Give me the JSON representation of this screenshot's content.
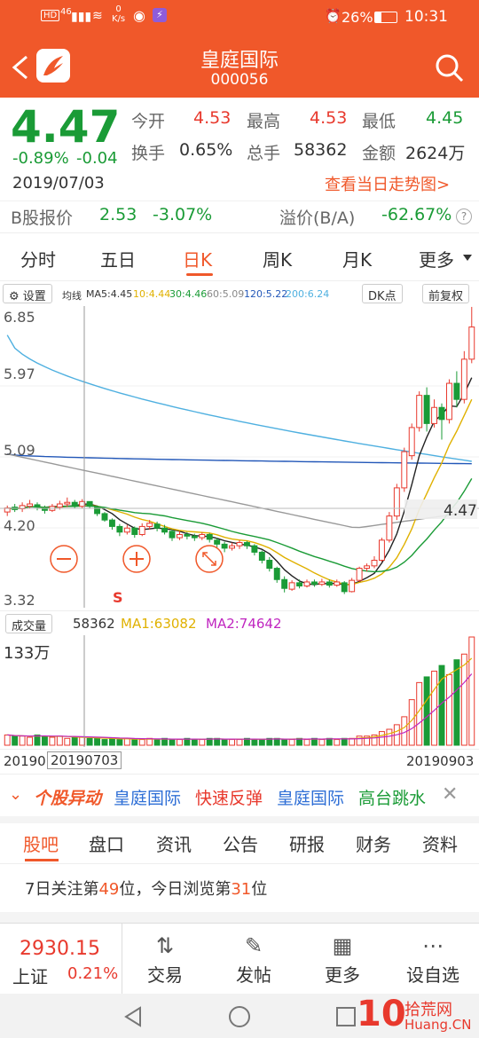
{
  "status": {
    "net": "46",
    "speed_top": "0",
    "speed_unit": "K/s",
    "battery": "26%",
    "time": "10:31"
  },
  "header": {
    "title": "皇庭国际",
    "code": "000056"
  },
  "quote": {
    "price": "4.47",
    "change_pct": "-0.89%",
    "change": "-0.04",
    "date": "2019/07/03",
    "fields": [
      {
        "label": "今开",
        "value": "4.53",
        "color": "red"
      },
      {
        "label": "最高",
        "value": "4.53",
        "color": "red"
      },
      {
        "label": "最低",
        "value": "4.45",
        "color": "green"
      },
      {
        "label": "换手",
        "value": "0.65%",
        "color": "normal"
      },
      {
        "label": "总手",
        "value": "58362",
        "color": "normal"
      },
      {
        "label": "金额",
        "value": "2624万",
        "color": "normal"
      }
    ],
    "trend_link": "查看当日走势图>",
    "b_label": "B股报价",
    "b_price": "2.53",
    "b_pct": "-3.07%",
    "premium_label": "溢价(B/A)",
    "premium_value": "-62.67%",
    "help_icon": "?"
  },
  "tabs": [
    "分时",
    "五日",
    "日K",
    "周K",
    "月K",
    "更多"
  ],
  "active_tab": 2,
  "chart_toolbar": {
    "settings": "设置",
    "ma_label": "均线",
    "ma5": "MA5:4.45",
    "ma10": "10:4.44",
    "ma30": "30:4.46",
    "ma60": "60:5.09",
    "ma120": "120:5.22",
    "ma200": "200:6.24",
    "dk": "DK点",
    "adjust": "前复权"
  },
  "chart_data": {
    "type": "candlestick",
    "y_ticks": [
      "6.85",
      "5.97",
      "5.09",
      "4.20",
      "3.32"
    ],
    "ylim": [
      3.32,
      6.85
    ],
    "current_price_label": "4.47",
    "marker": "S",
    "candles": [
      [
        4.4,
        4.45,
        4.35,
        4.48
      ],
      [
        4.46,
        4.43,
        4.4,
        4.5
      ],
      [
        4.44,
        4.48,
        4.4,
        4.52
      ],
      [
        4.47,
        4.5,
        4.44,
        4.55
      ],
      [
        4.49,
        4.46,
        4.42,
        4.52
      ],
      [
        4.45,
        4.42,
        4.38,
        4.48
      ],
      [
        4.42,
        4.47,
        4.4,
        4.5
      ],
      [
        4.46,
        4.5,
        4.43,
        4.54
      ],
      [
        4.5,
        4.52,
        4.46,
        4.58
      ],
      [
        4.52,
        4.47,
        4.45,
        4.55
      ],
      [
        4.47,
        4.53,
        4.44,
        4.56
      ],
      [
        4.53,
        4.47,
        4.45,
        4.53
      ],
      [
        4.46,
        4.38,
        4.35,
        4.48
      ],
      [
        4.38,
        4.3,
        4.28,
        4.4
      ],
      [
        4.3,
        4.22,
        4.18,
        4.32
      ],
      [
        4.22,
        4.15,
        4.1,
        4.25
      ],
      [
        4.15,
        4.2,
        4.12,
        4.24
      ],
      [
        4.2,
        4.12,
        4.08,
        4.22
      ],
      [
        4.12,
        4.22,
        4.1,
        4.26
      ],
      [
        4.22,
        4.26,
        4.18,
        4.3
      ],
      [
        4.25,
        4.2,
        4.16,
        4.28
      ],
      [
        4.2,
        4.15,
        4.12,
        4.24
      ],
      [
        4.16,
        4.08,
        4.04,
        4.18
      ],
      [
        4.08,
        4.12,
        4.05,
        4.16
      ],
      [
        4.12,
        4.1,
        4.06,
        4.15
      ],
      [
        4.1,
        4.08,
        4.04,
        4.13
      ],
      [
        4.08,
        4.12,
        4.05,
        4.15
      ],
      [
        4.12,
        4.06,
        4.02,
        4.14
      ],
      [
        4.05,
        4.0,
        3.96,
        4.08
      ],
      [
        4.0,
        3.95,
        3.9,
        4.03
      ],
      [
        3.95,
        3.98,
        3.92,
        4.02
      ],
      [
        3.98,
        4.02,
        3.94,
        4.05
      ],
      [
        4.02,
        3.98,
        3.94,
        4.04
      ],
      [
        3.98,
        3.9,
        3.86,
        4.0
      ],
      [
        3.9,
        3.8,
        3.76,
        3.92
      ],
      [
        3.8,
        3.7,
        3.66,
        3.84
      ],
      [
        3.7,
        3.56,
        3.52,
        3.72
      ],
      [
        3.56,
        3.45,
        3.4,
        3.6
      ],
      [
        3.44,
        3.52,
        3.42,
        3.55
      ],
      [
        3.52,
        3.48,
        3.45,
        3.56
      ],
      [
        3.48,
        3.53,
        3.46,
        3.56
      ],
      [
        3.53,
        3.5,
        3.47,
        3.56
      ],
      [
        3.5,
        3.53,
        3.48,
        3.57
      ],
      [
        3.53,
        3.49,
        3.46,
        3.56
      ],
      [
        3.49,
        3.53,
        3.47,
        3.56
      ],
      [
        3.52,
        3.41,
        3.38,
        3.54
      ],
      [
        3.41,
        3.55,
        3.4,
        3.58
      ],
      [
        3.55,
        3.7,
        3.53,
        3.72
      ],
      [
        3.7,
        3.73,
        3.66,
        3.76
      ],
      [
        3.73,
        3.8,
        3.7,
        3.85
      ],
      [
        3.8,
        4.05,
        3.78,
        4.08
      ],
      [
        4.05,
        4.35,
        4.02,
        4.4
      ],
      [
        4.35,
        4.7,
        4.3,
        4.75
      ],
      [
        4.7,
        5.15,
        4.65,
        5.2
      ],
      [
        5.1,
        5.45,
        5.05,
        5.5
      ],
      [
        5.45,
        5.85,
        5.4,
        5.9
      ],
      [
        5.85,
        5.5,
        5.4,
        5.95
      ],
      [
        5.5,
        5.7,
        5.45,
        5.8
      ],
      [
        5.7,
        5.55,
        5.3,
        5.75
      ],
      [
        5.55,
        6.0,
        5.5,
        6.05
      ],
      [
        6.0,
        5.8,
        5.7,
        6.15
      ],
      [
        5.8,
        6.3,
        5.75,
        6.4
      ],
      [
        6.3,
        6.7,
        6.25,
        6.95
      ]
    ],
    "volume": {
      "label": "成交量",
      "current": "58362",
      "ma1": "MA1:63082",
      "ma2": "MA2:74642",
      "max_label": "133万",
      "start_date": "20190",
      "cursor_date": "20190703",
      "end_date": "20190903",
      "values": [
        9,
        8,
        8,
        7,
        9,
        8,
        7,
        8,
        6,
        7,
        7,
        6,
        6,
        5,
        6,
        5,
        6,
        5,
        5,
        6,
        5,
        6,
        5,
        5,
        6,
        5,
        5,
        6,
        6,
        5,
        5,
        5,
        6,
        5,
        5,
        6,
        6,
        5,
        5,
        6,
        5,
        6,
        5,
        6,
        5,
        6,
        6,
        8,
        8,
        9,
        12,
        14,
        18,
        25,
        40,
        55,
        60,
        65,
        70,
        62,
        75,
        80,
        95
      ]
    }
  },
  "news": {
    "badge": "个股异动",
    "items": [
      {
        "text": "皇庭国际",
        "color": "blue"
      },
      {
        "text": "快速反弹",
        "color": "red"
      },
      {
        "text": "皇庭国际",
        "color": "blue"
      },
      {
        "text": "高台跳水",
        "color": "green"
      }
    ],
    "close": "✕"
  },
  "sub_tabs": [
    "股吧",
    "盘口",
    "资讯",
    "公告",
    "研报",
    "财务",
    "资料"
  ],
  "rank": {
    "prefix": "7日关注第",
    "n1": "49",
    "mid": "位，今日浏览第",
    "n2": "31",
    "suffix": "位"
  },
  "index": {
    "value": "2930.15",
    "name": "上证",
    "pct": "0.21%"
  },
  "bottom_tabs": [
    {
      "label": "交易",
      "icon": "trade-icon"
    },
    {
      "label": "发帖",
      "icon": "edit-icon"
    },
    {
      "label": "更多",
      "icon": "grid-icon"
    },
    {
      "label": "设自选",
      "icon": "more-dots-icon"
    }
  ],
  "watermark": {
    "number": "10",
    "site": "拾荒网",
    "url": "Huang.CN"
  },
  "colors": {
    "brand": "#f0582a",
    "up": "#e8392d",
    "down": "#1a9b36"
  }
}
